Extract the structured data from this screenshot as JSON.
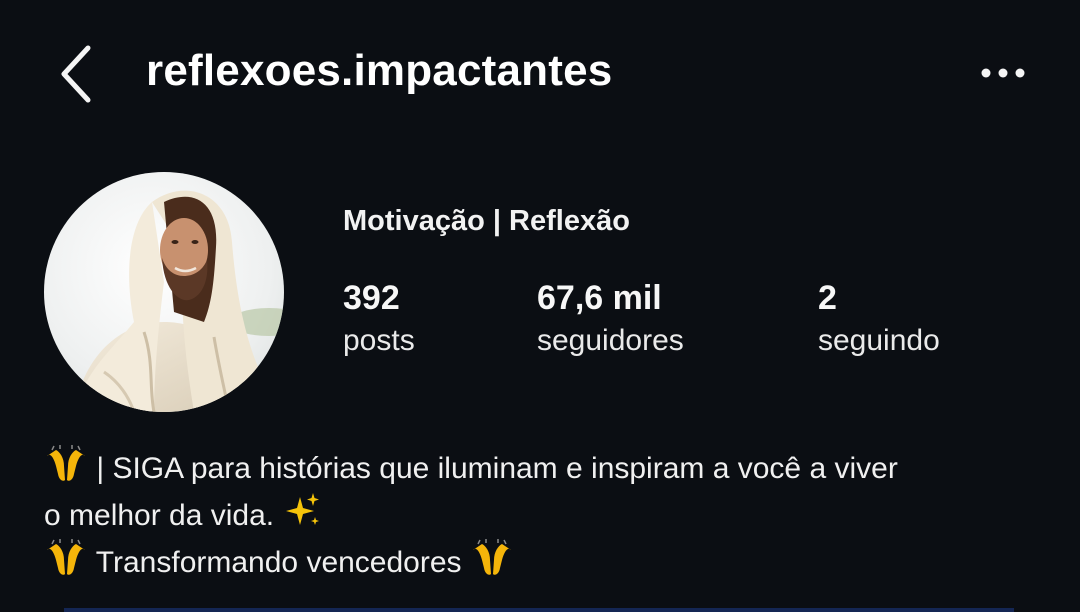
{
  "header": {
    "username": "reflexoes.impactantes",
    "back_icon": "chevron-left-icon",
    "more_icon": "more-horizontal-icon"
  },
  "profile": {
    "category": "Motivação | Reflexão",
    "avatar_icon": "profile-avatar"
  },
  "stats": [
    {
      "value": "392",
      "label": "posts"
    },
    {
      "value": "67,6 mil",
      "label": "seguidores"
    },
    {
      "value": "2",
      "label": "seguindo"
    }
  ],
  "bio": {
    "line1_emoji": "🙌",
    "line1_text": " | SIGA para histórias que iluminam e inspiram a você a viver",
    "line2_text": "o melhor da vida. ",
    "line2_emoji": "✨",
    "line3_emoji_start": "🙌",
    "line3_text": " Transformando vencedores ",
    "line3_emoji_end": "🙌"
  },
  "colors": {
    "background": "#0b0e13",
    "text": "#f5f5f5",
    "emoji_yellow": "#f5b50a"
  }
}
